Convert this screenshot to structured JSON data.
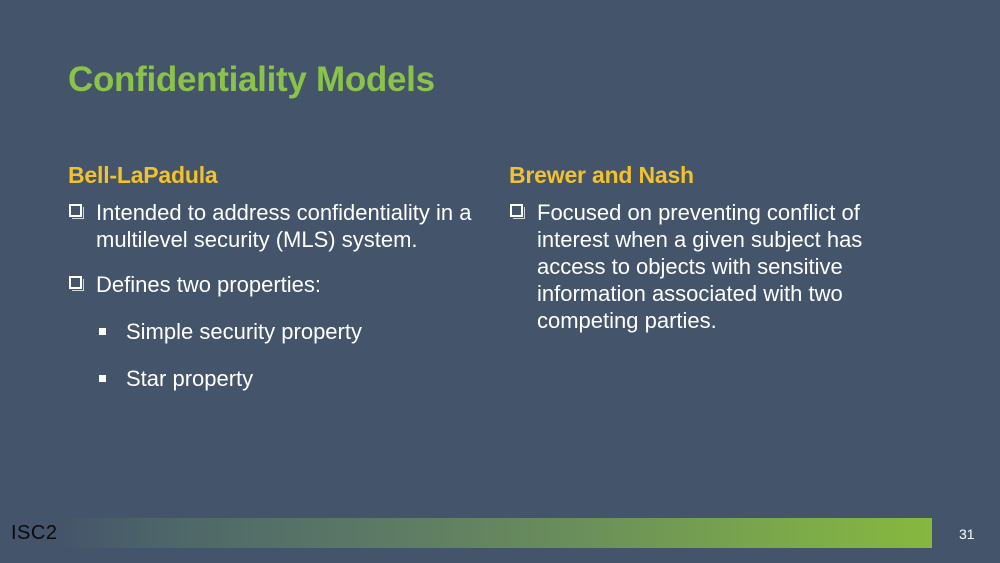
{
  "slide": {
    "title": "Confidentiality Models",
    "page_number": "31",
    "logo_text": "ISC2",
    "colors": {
      "background": "#44546a",
      "title": "#8bc34a",
      "heading": "#f2c12e",
      "text": "#ffffff"
    }
  },
  "left_column": {
    "heading": "Bell-LaPadula",
    "bullets": [
      "Intended to address confidentiality in a multilevel security (MLS) system.",
      "Defines two properties:"
    ],
    "sub_bullets": [
      "Simple security property",
      "Star property"
    ]
  },
  "right_column": {
    "heading": "Brewer and Nash",
    "bullets": [
      "Focused on preventing conflict of interest when a given subject has access to objects with sensitive information associated with two competing parties."
    ]
  }
}
